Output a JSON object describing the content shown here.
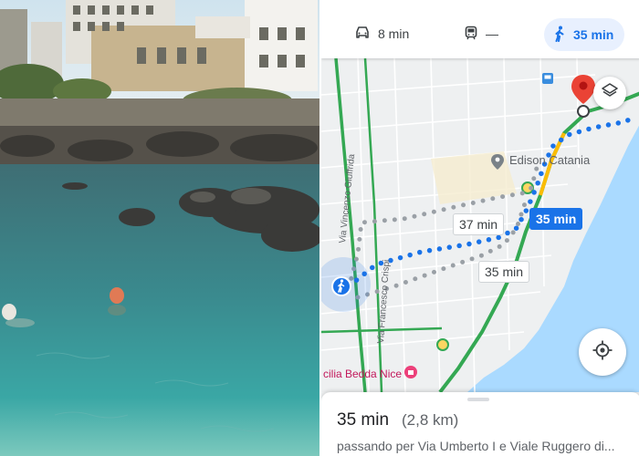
{
  "travel_modes": {
    "drive": {
      "time": "8 min",
      "icon": "car-icon"
    },
    "transit": {
      "time": "—",
      "icon": "train-icon"
    },
    "walk": {
      "time": "35 min",
      "icon": "walking-icon",
      "selected": true
    }
  },
  "map": {
    "routes": [
      {
        "label": "35 min",
        "selected": true
      },
      {
        "label": "37 min",
        "selected": false
      },
      {
        "label": "35 min",
        "selected": false
      }
    ],
    "place_labels": {
      "destination": "Edison Catania",
      "bottom": "cilia Bedda Nice"
    },
    "road_labels": {
      "left": "Via Vincenzo Giuffrida",
      "middle": "Via Francesco Crispi"
    },
    "colors": {
      "route_selected": "#1a73e8",
      "route_alternative": "#9aa0a6",
      "traffic": "#34a853",
      "destination_pin": "#ea4335",
      "sea": "#aadaff"
    }
  },
  "sheet": {
    "duration": "35 min",
    "distance": "(2,8 km)",
    "via": "passando per Via Umberto I e Viale Ruggero di..."
  }
}
